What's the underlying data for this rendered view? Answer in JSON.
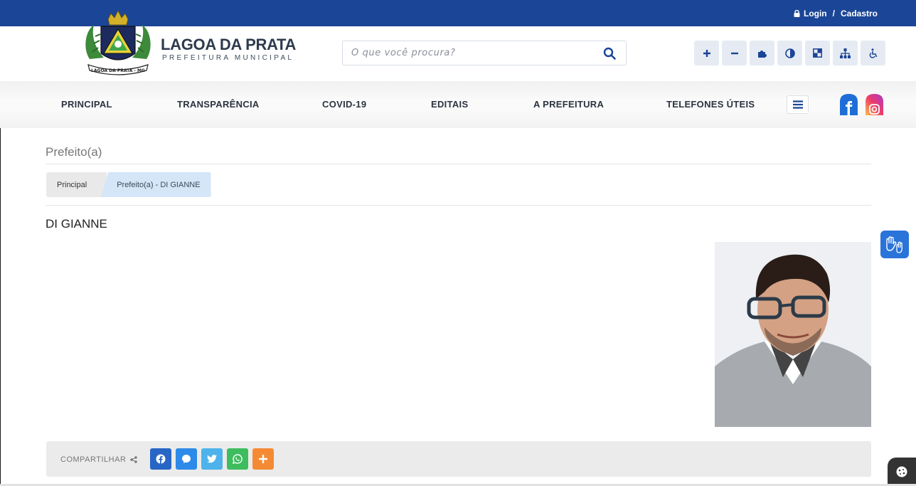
{
  "topbar": {
    "login": "Login",
    "separator": "/",
    "register": "Cadastro"
  },
  "brand": {
    "title": "LAGOA DA PRATA",
    "subtitle": "PREFEITURA MUNICIPAL",
    "emblem_text": "LAGOA DA PRATA - MG"
  },
  "search": {
    "placeholder": "O que você procura?"
  },
  "a11y": [
    {
      "label": "+",
      "icon": "font-increase-icon"
    },
    {
      "label": "−",
      "icon": "font-decrease-icon"
    },
    {
      "label": "",
      "icon": "puzzle-icon"
    },
    {
      "label": "",
      "icon": "contrast-icon"
    },
    {
      "label": "",
      "icon": "high-contrast-icon"
    },
    {
      "label": "",
      "icon": "sitemap-icon"
    },
    {
      "label": "",
      "icon": "wheelchair-icon"
    }
  ],
  "nav": [
    "PRINCIPAL",
    "TRANSPARÊNCIA",
    "COVID-19",
    "EDITAIS",
    "A PREFEITURA",
    "TELEFONES ÚTEIS"
  ],
  "page": {
    "title": "Prefeito(a)",
    "person_name": "DI GIANNE"
  },
  "breadcrumb": {
    "home": "Principal",
    "current": "Prefeito(a) - DI GIANNE"
  },
  "share": {
    "label": "COMPARTILHAR",
    "buttons": [
      {
        "icon": "facebook-icon",
        "color": "#2866c6"
      },
      {
        "icon": "messenger-icon",
        "color": "#2d8ae8"
      },
      {
        "icon": "twitter-icon",
        "color": "#4db3ea"
      },
      {
        "icon": "whatsapp-icon",
        "color": "#3dbd5e"
      },
      {
        "icon": "plus-icon",
        "color": "#f58a34"
      }
    ]
  },
  "colors": {
    "topbar": "#1b4596",
    "accent": "#1b4596"
  }
}
